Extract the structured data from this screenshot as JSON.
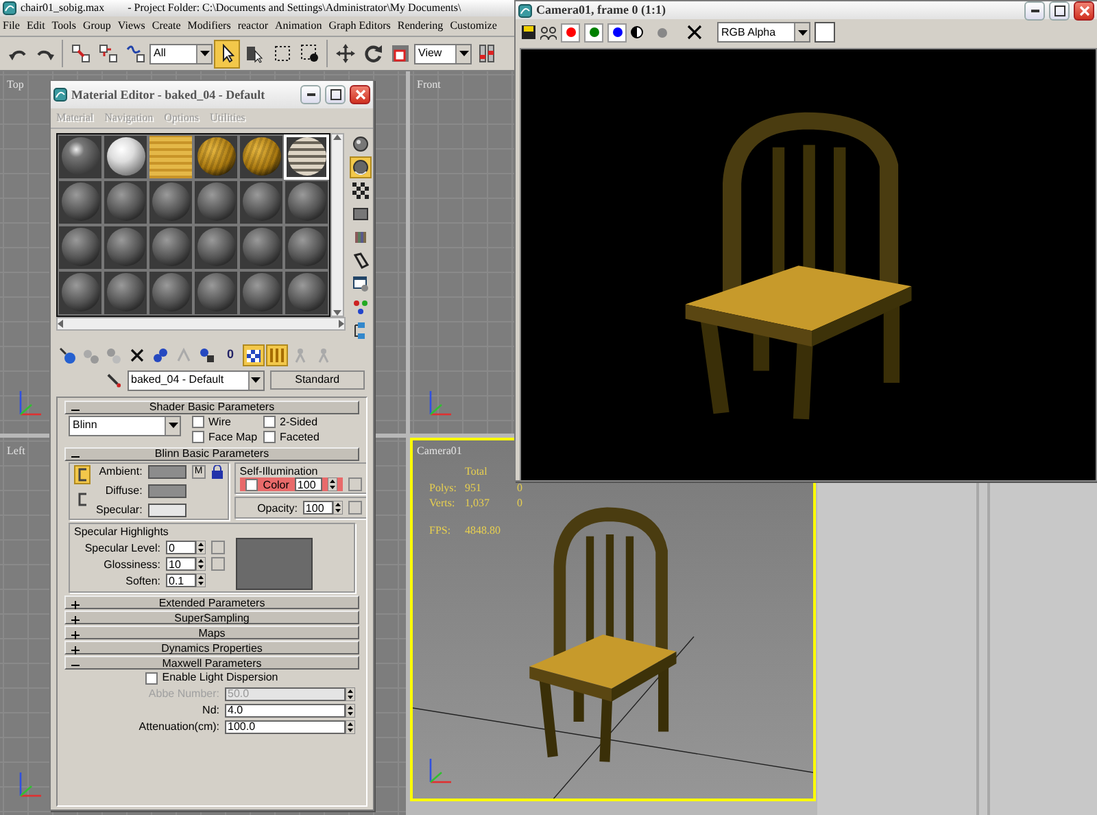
{
  "app": {
    "title": "chair01_sobig.max",
    "project_path": "- Project Folder: C:\\Documents and Settings\\Administrator\\My Documents\\",
    "menu": [
      "File",
      "Edit",
      "Tools",
      "Group",
      "Views",
      "Create",
      "Modifiers",
      "reactor",
      "Animation",
      "Graph Editors",
      "Rendering",
      "Customize"
    ],
    "toolbar": {
      "tools": [
        {
          "selected": false
        },
        {
          "selected": false
        },
        {
          "selected": false
        },
        {
          "selected": false
        },
        {
          "selected": false
        },
        {
          "selected": true
        },
        {
          "selected": false
        },
        {
          "selected": false
        },
        {
          "selected": false
        },
        {
          "selected": false
        },
        {
          "selected": false
        },
        {
          "selected": false
        },
        {
          "selected": false
        }
      ],
      "selection_filter": "All",
      "reference_coordinate_system": "View"
    }
  },
  "viewports": [
    {
      "label": "Top",
      "kind": "orthographic",
      "selected": false
    },
    {
      "label": "Front",
      "kind": "orthographic",
      "selected": false
    },
    {
      "label": "Left",
      "kind": "orthographic",
      "selected": false
    },
    {
      "label": "Camera01",
      "kind": "perspective",
      "selected": true,
      "stats": {
        "header": "Total",
        "rows": [
          {
            "label": "Polys:",
            "total": "951",
            "column_3": "0"
          },
          {
            "label": "Verts:",
            "total": "1,037",
            "column_3": "0"
          }
        ],
        "fps_label": "FPS:",
        "fps": "4848.80"
      }
    }
  ],
  "material_editor": {
    "title": "Material Editor - baked_04 - Default",
    "menu": [
      {
        "label": "Material",
        "disabled": true
      },
      {
        "label": "Navigation",
        "disabled": true
      },
      {
        "label": "Options",
        "disabled": true
      },
      {
        "label": "Utilities",
        "disabled": true
      }
    ],
    "slots": [
      {
        "kind": "glossy",
        "selected": false
      },
      {
        "kind": "white",
        "selected": false
      },
      {
        "kind": "wood-flat",
        "selected": false
      },
      {
        "kind": "wood",
        "selected": false
      },
      {
        "kind": "wood",
        "selected": false
      },
      {
        "kind": "striped",
        "selected": true
      },
      {
        "kind": "default",
        "selected": false
      },
      {
        "kind": "default",
        "selected": false
      },
      {
        "kind": "default",
        "selected": false
      },
      {
        "kind": "default",
        "selected": false
      },
      {
        "kind": "default",
        "selected": false
      },
      {
        "kind": "default",
        "selected": false
      },
      {
        "kind": "default",
        "selected": false
      },
      {
        "kind": "default",
        "selected": false
      },
      {
        "kind": "default",
        "selected": false
      },
      {
        "kind": "default",
        "selected": false
      },
      {
        "kind": "default",
        "selected": false
      },
      {
        "kind": "default",
        "selected": false
      },
      {
        "kind": "default",
        "selected": false
      },
      {
        "kind": "default",
        "selected": false
      },
      {
        "kind": "default",
        "selected": false
      },
      {
        "kind": "default",
        "selected": false
      },
      {
        "kind": "default",
        "selected": false
      },
      {
        "kind": "default",
        "selected": false
      }
    ],
    "side_tools": [
      {
        "selected": false
      },
      {
        "selected": true
      },
      {
        "selected": false
      },
      {
        "selected": false
      },
      {
        "selected": false
      },
      {
        "selected": false
      },
      {
        "selected": false
      },
      {
        "selected": false
      },
      {
        "selected": false
      }
    ],
    "bottom_tools": [
      {
        "selected": false
      },
      {
        "selected": false
      },
      {
        "selected": false
      },
      {
        "selected": false
      },
      {
        "selected": false
      },
      {
        "selected": false
      },
      {
        "selected": false
      },
      {
        "label": "0",
        "selected": false
      },
      {
        "selected": true
      },
      {
        "selected": true
      },
      {
        "selected": false
      },
      {
        "selected": false
      }
    ],
    "material_name": "baked_04 - Default",
    "material_type": "Standard",
    "rollouts": [
      {
        "title": "Shader Basic Parameters",
        "expanded": true,
        "kind": "shader",
        "shader": "Blinn",
        "options": [
          {
            "label": "Wire",
            "checked": false
          },
          {
            "label": "2-Sided",
            "checked": false
          },
          {
            "label": "Face Map",
            "checked": false
          },
          {
            "label": "Faceted",
            "checked": false
          }
        ]
      },
      {
        "title": "Blinn Basic Parameters",
        "expanded": true,
        "kind": "blinn",
        "lock_buttons": [
          {
            "selected": true
          },
          {
            "selected": false
          }
        ],
        "colors": [
          {
            "label": "Ambient:",
            "color": "#8c8c8c"
          },
          {
            "label": "Diffuse:",
            "color": "#8c8c8c"
          },
          {
            "label": "Specular:",
            "color": "#e6e6e6"
          }
        ],
        "map_button": "M",
        "self_illumination": {
          "title": "Self-Illumination",
          "label": "Color",
          "checked": false,
          "value": "100",
          "highlighted": true
        },
        "opacity": {
          "label": "Opacity:",
          "value": "100"
        },
        "specular_highlights": {
          "title": "Specular Highlights",
          "fields": [
            {
              "label": "Specular Level:",
              "value": "0"
            },
            {
              "label": "Glossiness:",
              "value": "10"
            },
            {
              "label": "Soften:",
              "value": "0.1"
            }
          ]
        }
      },
      {
        "title": "Extended Parameters",
        "expanded": false
      },
      {
        "title": "SuperSampling",
        "expanded": false
      },
      {
        "title": "Maps",
        "expanded": false
      },
      {
        "title": "Dynamics Properties",
        "expanded": false
      },
      {
        "title": "Maxwell Parameters",
        "expanded": true,
        "kind": "maxwell",
        "option": {
          "label": "Enable Light Dispersion",
          "checked": false
        },
        "fields": [
          {
            "label": "Abbe Number:",
            "value": "50.0",
            "disabled": true
          },
          {
            "label": "Nd:",
            "value": "4.0",
            "disabled": false
          },
          {
            "label": "Attenuation(cm):",
            "value": "100.0",
            "disabled": false
          }
        ]
      }
    ]
  },
  "render_window": {
    "title": "Camera01, frame 0 (1:1)",
    "channels": [
      {
        "color": "#ff0000",
        "selected": true
      },
      {
        "color": "#008000",
        "selected": true
      },
      {
        "color": "#0000ff",
        "selected": true
      }
    ],
    "display_channel": "RGB Alpha"
  }
}
